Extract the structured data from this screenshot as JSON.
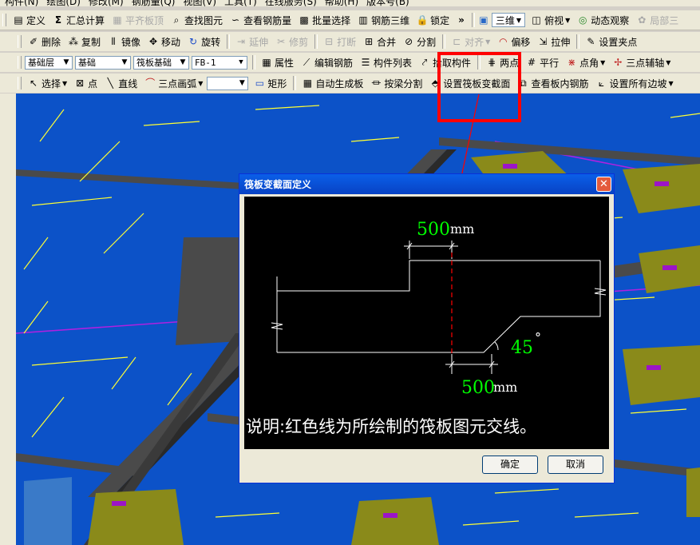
{
  "menubar": [
    "构件(N)",
    "绘图(D)",
    "修改(M)",
    "钢筋量(Q)",
    "视图(V)",
    "工具(T)",
    "在线服务(S)",
    "帮助(H)",
    "版本号(B)"
  ],
  "toolbar1": {
    "define": "定义",
    "summary": "汇总计算",
    "align_slab": "平齐板顶",
    "find_element": "查找图元",
    "view_rebar": "查看钢筋量",
    "batch_select": "批量选择",
    "rebar_3d": "钢筋三维",
    "lock": "锁定",
    "view_mode": "三维",
    "top_view": "俯视",
    "dynamic_view": "动态观察",
    "local_3d": "局部三"
  },
  "toolbar2": {
    "delete": "删除",
    "copy": "复制",
    "mirror": "镜像",
    "move": "移动",
    "rotate": "旋转",
    "extend": "延伸",
    "trim": "修剪",
    "break": "打断",
    "merge": "合并",
    "split": "分割",
    "align": "对齐",
    "offset": "偏移",
    "stretch": "拉伸",
    "set_grip": "设置夹点"
  },
  "toolbar3": {
    "layer": "基础层",
    "category": "基础",
    "type": "筏板基础",
    "component": "FB-1",
    "properties": "属性",
    "edit_rebar": "编辑钢筋",
    "component_list": "构件列表",
    "pick_component": "拾取构件",
    "two_points": "两点",
    "parallel": "平行",
    "point_angle": "点角",
    "three_point_axis": "三点辅轴"
  },
  "toolbar4": {
    "select": "选择",
    "point": "点",
    "line": "直线",
    "arc": "三点画弧",
    "rect": "矩形",
    "auto_slab": "自动生成板",
    "split_by_beam": "按梁分割",
    "set_section": "设置筏板变截面",
    "view_slab_rebar": "查看板内钢筋",
    "set_all_slopes": "设置所有边坡"
  },
  "dialog": {
    "title": "筏板变截面定义",
    "dim_top": "500",
    "dim_top_unit": "mm",
    "dim_bottom": "500",
    "dim_bottom_unit": "mm",
    "angle": "45",
    "angle_unit": "°",
    "note": "说明:红色线为所绘制的筏板图元交线。",
    "ok": "确定",
    "cancel": "取消"
  },
  "colors": {
    "viewport_bg": "#0c52c8",
    "highlight": "#ff0000",
    "dim_text": "#00ff00",
    "grid_line": "#ffff33",
    "beam": "#4a4a4a",
    "olive": "#8a8a1a",
    "purple": "#9c14c8"
  }
}
